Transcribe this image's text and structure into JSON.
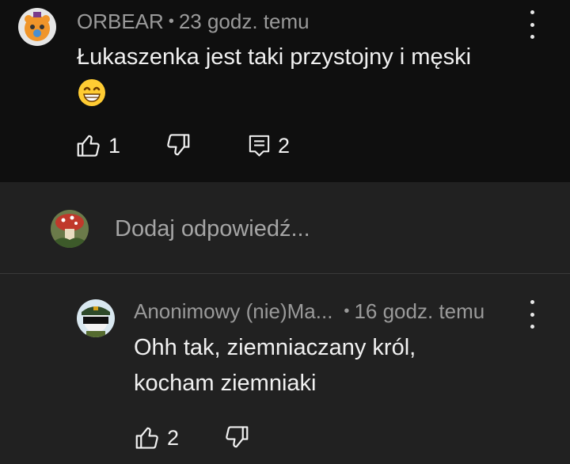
{
  "comment": {
    "author": "ORBEAR",
    "separator": "•",
    "time": "23 godz. temu",
    "text": "Łukaszenka jest taki przystojny i  męski",
    "emoji": "😁",
    "likes": "1",
    "replies": "2"
  },
  "reply_box": {
    "placeholder": "Dodaj odpowiedź..."
  },
  "reply": {
    "author": "Anonimowy (nie)Ma...",
    "separator": "•",
    "time": "16 godz. temu",
    "text_line1": "Ohh tak, ziemniaczany król,",
    "text_line2": "kocham ziemniaki",
    "likes": "2"
  },
  "colors": {
    "comment_bg": "#0f0f0f",
    "reply_bg": "#212121",
    "text_primary": "#f1f1f1",
    "text_secondary": "#9a9a9a"
  },
  "icons": [
    "avatar-orbear",
    "more-vert-icon",
    "thumb-up-icon",
    "thumb-down-icon",
    "replies-icon",
    "avatar-user",
    "avatar-anon"
  ]
}
